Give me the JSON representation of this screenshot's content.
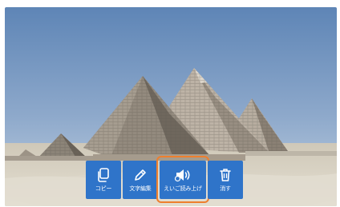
{
  "photo": {
    "subject": "pyramids-photo"
  },
  "toolbar": {
    "buttons": [
      {
        "id": "copy",
        "label": "コピー",
        "icon": "copy-icon"
      },
      {
        "id": "edit",
        "label": "文字編集",
        "icon": "pencil-icon"
      },
      {
        "id": "read",
        "label": "えいご読み上げ",
        "icon": "speaker-icon",
        "highlighted": true
      },
      {
        "id": "delete",
        "label": "消す",
        "icon": "trash-icon"
      }
    ]
  },
  "colors": {
    "button_blue": "#2f74c9",
    "highlight_orange": "#ee7f2e",
    "sky_top": "#5f86b7",
    "sky_bottom": "#b9cce0",
    "sand": "#d8d2c3"
  }
}
